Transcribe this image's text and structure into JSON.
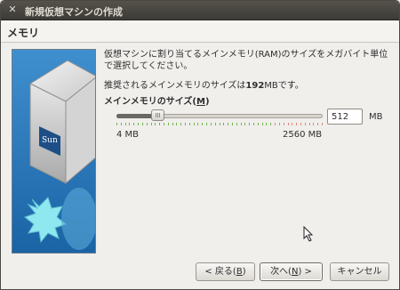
{
  "window": {
    "title": "新規仮想マシンの作成",
    "close_icon": "close-icon"
  },
  "header": {
    "title": "メモリ"
  },
  "content": {
    "description": "仮想マシンに割り当てるメインメモリ(RAM)のサイズをメガバイト単位で選択してください。",
    "recommendation_prefix": "推奨されるメインメモリのサイズは",
    "recommendation_value": "192",
    "recommendation_suffix": "MBです。",
    "size_label_text": "メインメモリのサイズ(",
    "size_label_key": "M",
    "size_label_end": ")",
    "slider": {
      "min": 4,
      "max": 2560,
      "value": 512,
      "min_label": "4 MB",
      "max_label": "2560 MB"
    },
    "memory_value": "512",
    "unit": "MB"
  },
  "buttons": {
    "back_text": "< 戻る(",
    "back_key": "B",
    "back_end": ")",
    "next_text": "次へ(",
    "next_key": "N",
    "next_end": ") >",
    "cancel": "キャンセル"
  },
  "colors": {
    "title_bar": "#3c3b37",
    "tick_green": "#73b34f",
    "tick_red": "#e08a7d"
  }
}
